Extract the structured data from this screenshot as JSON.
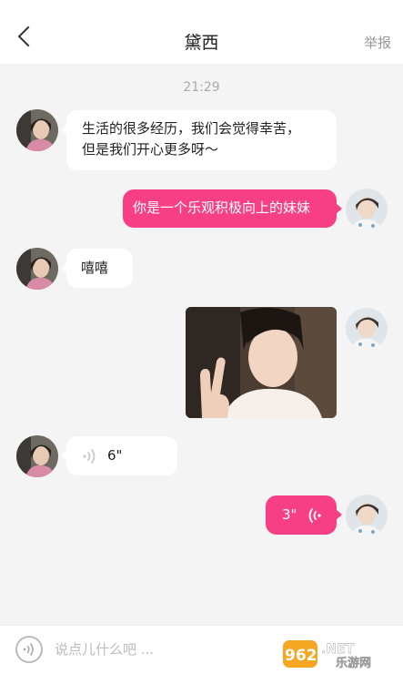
{
  "header": {
    "title": "黛西",
    "report_label": "举报"
  },
  "timestamp": "21:29",
  "messages": [
    {
      "from": "other",
      "type": "text",
      "text": [
        "生活的很多经历，我们会觉得幸苦，",
        "但是我们开心更多呀～"
      ]
    },
    {
      "from": "self",
      "type": "text",
      "text": "你是一个乐观积极向上的妹妹"
    },
    {
      "from": "other",
      "type": "text",
      "text": "嘻嘻"
    },
    {
      "from": "self",
      "type": "image"
    },
    {
      "from": "other",
      "type": "voice",
      "duration": "6\""
    },
    {
      "from": "self",
      "type": "voice",
      "duration": "3\""
    }
  ],
  "input": {
    "placeholder": "说点儿什么吧 ..."
  },
  "watermark": {
    "number": "962",
    "suffix": ".NET",
    "site": "乐游网"
  },
  "colors": {
    "accent": "#f73f85",
    "background": "#f4f4f4",
    "bubble_in": "#ffffff"
  }
}
